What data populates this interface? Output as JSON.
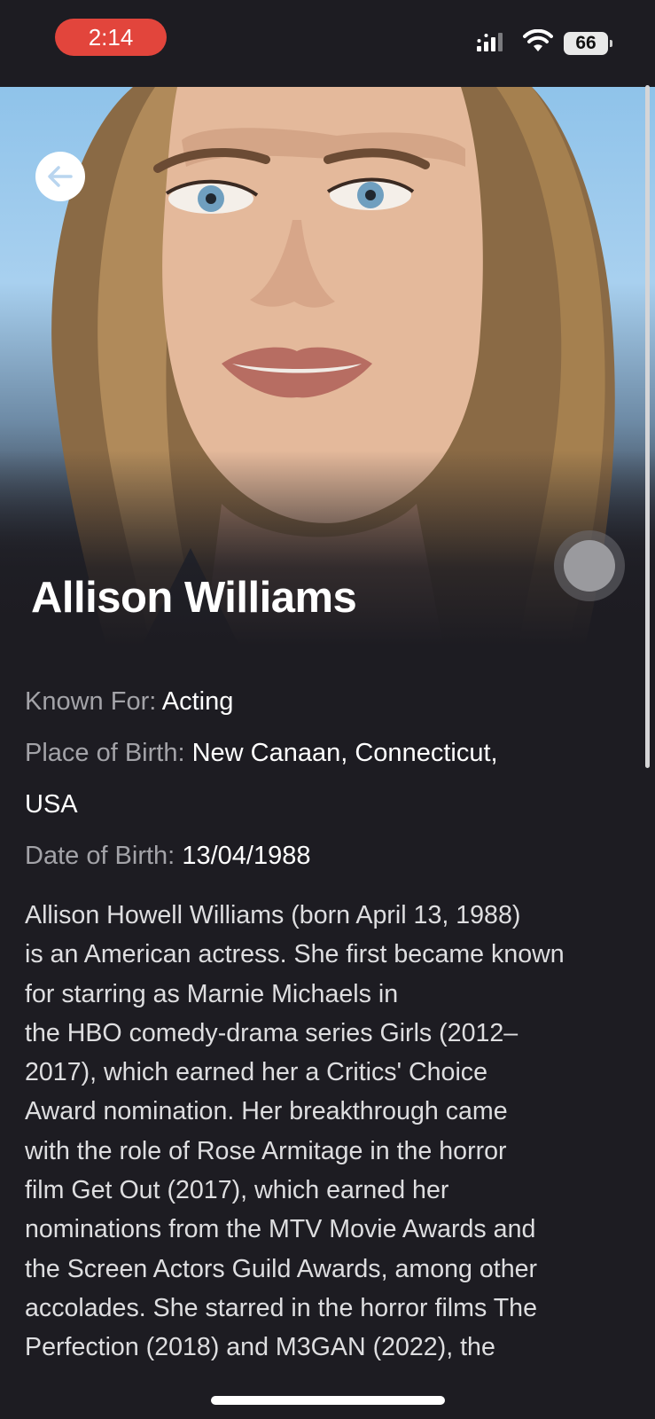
{
  "status_bar": {
    "time": "2:14",
    "battery": "66"
  },
  "profile": {
    "name": "Allison Williams",
    "known_for": {
      "label": "Known For: ",
      "value": "Acting"
    },
    "place_of_birth": {
      "label": "Place of Birth: ",
      "value": "New Canaan, Connecticut,",
      "value_cont": "USA"
    },
    "date_of_birth": {
      "label": "Date of Birth: ",
      "value": "13/04/1988"
    },
    "biography": [
      "Allison Howell Williams (born April 13, 1988)",
      "is an American actress. She first became known",
      "for starring as Marnie Michaels in",
      "the HBO comedy-drama series Girls (2012–",
      "2017), which earned her a Critics' Choice",
      "Award nomination. Her breakthrough came",
      "with the role of Rose Armitage in the horror",
      "film Get Out (2017), which earned her",
      "nominations from the MTV Movie Awards and",
      "the Screen Actors Guild Awards, among other",
      "accolades. She starred in the horror films The",
      "Perfection (2018) and M3GAN (2022), the"
    ]
  },
  "icons": {
    "back": "arrow-left-icon",
    "fab": "circle-button-icon",
    "signal": "signal-icon",
    "wifi": "wifi-icon"
  },
  "colors": {
    "background": "#1d1c22",
    "time_pill": "#e2453c",
    "label": "#a3a3a8",
    "value": "#ffffff",
    "body_text": "#dedee0"
  }
}
